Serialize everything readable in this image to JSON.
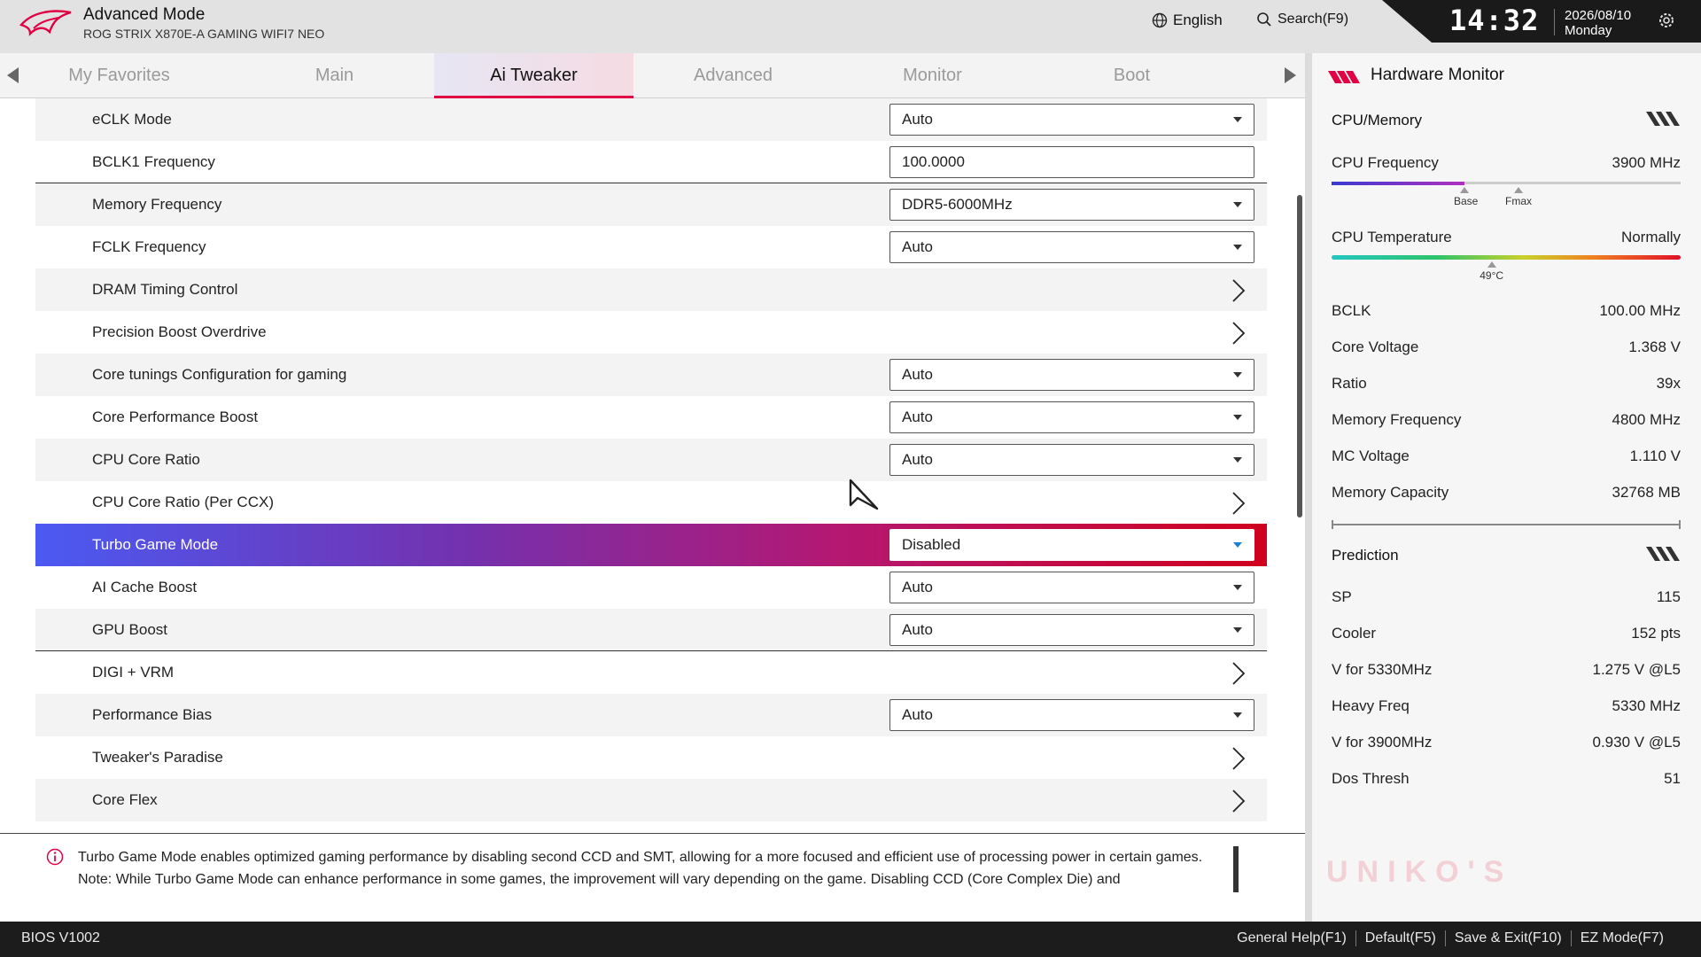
{
  "header": {
    "mode_title": "Advanced Mode",
    "board_name": "ROG STRIX X870E-A GAMING WIFI7 NEO",
    "language": "English",
    "search_label": "Search(F9)",
    "time": "14:32",
    "date": "2026/08/10",
    "weekday": "Monday",
    "accent_color": "#e00044"
  },
  "tabs": [
    {
      "label": "My Favorites"
    },
    {
      "label": "Main"
    },
    {
      "label": "Ai Tweaker",
      "active": true
    },
    {
      "label": "Advanced"
    },
    {
      "label": "Monitor"
    },
    {
      "label": "Boot"
    }
  ],
  "settings": [
    {
      "label": "eCLK Mode",
      "value": "Auto",
      "control": "dropdown"
    },
    {
      "label": "BCLK1 Frequency",
      "value": "100.0000",
      "control": "input"
    },
    {
      "label": "Memory Frequency",
      "value": "DDR5-6000MHz",
      "control": "dropdown"
    },
    {
      "label": "FCLK Frequency",
      "value": "Auto",
      "control": "dropdown"
    },
    {
      "label": "DRAM Timing Control",
      "control": "submenu"
    },
    {
      "label": "Precision Boost Overdrive",
      "control": "submenu"
    },
    {
      "label": "Core tunings Configuration for gaming",
      "value": "Auto",
      "control": "dropdown"
    },
    {
      "label": "Core Performance Boost",
      "value": "Auto",
      "control": "dropdown"
    },
    {
      "label": "CPU Core Ratio",
      "value": "Auto",
      "control": "dropdown"
    },
    {
      "label": "CPU Core Ratio (Per CCX)",
      "control": "submenu"
    },
    {
      "label": "Turbo Game Mode",
      "value": "Disabled",
      "control": "dropdown",
      "selected": true
    },
    {
      "label": "AI Cache Boost",
      "value": "Auto",
      "control": "dropdown"
    },
    {
      "label": "GPU Boost",
      "value": "Auto",
      "control": "dropdown"
    },
    {
      "label": "DIGI + VRM",
      "control": "submenu"
    },
    {
      "label": "Performance Bias",
      "value": "Auto",
      "control": "dropdown"
    },
    {
      "label": "Tweaker's Paradise",
      "control": "submenu"
    },
    {
      "label": "Core Flex",
      "control": "submenu"
    }
  ],
  "help": {
    "line1": "Turbo Game Mode enables optimized gaming performance by disabling second CCD and SMT, allowing for a more focused and efficient use of processing power in certain games.",
    "line2": "Note: While Turbo Game Mode can enhance performance in some games, the improvement will vary depending on the game. Disabling CCD (Core Complex Die) and"
  },
  "hardware_monitor": {
    "title": "Hardware Monitor",
    "cpu_memory_title": "CPU/Memory",
    "cpu_frequency": {
      "label": "CPU Frequency",
      "value": "3900 MHz",
      "base_label": "Base",
      "fmax_label": "Fmax",
      "fill_fraction": 0.38
    },
    "cpu_temperature": {
      "label": "CPU Temperature",
      "status": "Normally",
      "value": "49°C",
      "position_fraction": 0.46
    },
    "cpu_stats": [
      {
        "label": "BCLK",
        "value": "100.00 MHz"
      },
      {
        "label": "Core Voltage",
        "value": "1.368 V"
      },
      {
        "label": "Ratio",
        "value": "39x"
      },
      {
        "label": "Memory Frequency",
        "value": "4800 MHz"
      },
      {
        "label": "MC Voltage",
        "value": "1.110 V"
      },
      {
        "label": "Memory Capacity",
        "value": "32768 MB"
      }
    ],
    "prediction_title": "Prediction",
    "prediction": [
      {
        "label": "SP",
        "value": "115"
      },
      {
        "label": "Cooler",
        "value": "152 pts"
      },
      {
        "label": "V for 5330MHz",
        "value": "1.275 V @L5"
      },
      {
        "label": "Heavy Freq",
        "value": "5330 MHz"
      },
      {
        "label": "V for 3900MHz",
        "value": "0.930 V @L5"
      },
      {
        "label": "Dos Thresh",
        "value": "51"
      }
    ]
  },
  "watermark": "UNIKO'S",
  "footer": {
    "bios_version": "BIOS V1002",
    "keys": [
      "General Help(F1)",
      "Default(F5)",
      "Save & Exit(F10)",
      "EZ Mode(F7)"
    ]
  }
}
